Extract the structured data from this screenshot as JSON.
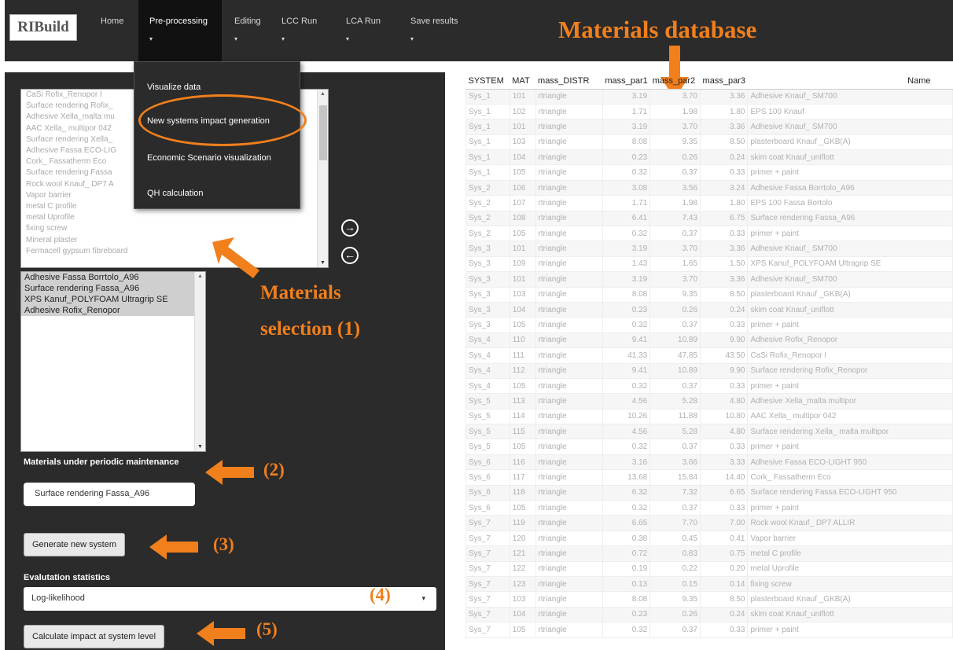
{
  "navbar": {
    "logo": "RIBuild",
    "items": [
      {
        "label": "Home"
      },
      {
        "label": "Pre-processing"
      },
      {
        "label": "Editing"
      },
      {
        "label": "LCC Run"
      },
      {
        "label": "LCA Run"
      },
      {
        "label": "Save results"
      }
    ],
    "caret": "▾"
  },
  "dropdown": {
    "items": [
      {
        "label": "Visualize data"
      },
      {
        "label": "New systems impact generation"
      },
      {
        "label": "Economic Scenario visualization"
      },
      {
        "label": "QH calculation"
      }
    ]
  },
  "materials_list": [
    "CaSi Rofix_Renopor I",
    "Surface rendering Rofix_",
    "Adhesive Xella_malta mu",
    "AAC Xella_ multipor 042",
    "Surface rendering Xella_",
    "Adhesive Fassa ECO-LIG",
    "Cork_ Fassatherm Eco",
    "Surface rendering Fassa",
    "Rock wool Knauf_ DP7 A",
    "Vapor barrier",
    "metal C profile",
    "metal Uprofile",
    "fixing screw",
    "Mineral plaster",
    "Fermacell gypsum fibreboard"
  ],
  "selected_materials": [
    "Adhesive Fassa Borrtolo_A96",
    "Surface rendering Fassa_A96",
    "XPS Kanuf_POLYFOAM Ultragrip SE",
    "Adhesive Rofix_Renopor"
  ],
  "controls": {
    "periodic_label": "Materials under periodic maintenance",
    "periodic_value": "Surface rendering Fassa_A96",
    "generate_button": "Generate new system",
    "eval_label": "Evalutation statistics",
    "eval_value": "Log-likelihood",
    "calc_button": "Calculate impact at system level"
  },
  "annotations": {
    "db_title": "Materials database",
    "selection_line1": "Materials",
    "selection_line2": "selection (1)",
    "n2": "(2)",
    "n3": "(3)",
    "n4": "(4)",
    "n5": "(5)"
  },
  "colors": {
    "accent": "#f07f1c",
    "dark": "#2b2b2b"
  },
  "table": {
    "headers": [
      "SYSTEM",
      "MAT",
      "mass_DISTR",
      "mass_par1",
      "mass_par2",
      "mass_par3",
      "Name"
    ],
    "rows": [
      [
        "Sys_1",
        "101",
        "rtriangle",
        "3.19",
        "3.70",
        "3.36",
        "Adhesive Knauf_ SM700"
      ],
      [
        "Sys_1",
        "102",
        "rtriangle",
        "1.71",
        "1.98",
        "1.80",
        "EPS 100 Knauf"
      ],
      [
        "Sys_1",
        "101",
        "rtriangle",
        "3.19",
        "3.70",
        "3.36",
        "Adhesive Knauf_ SM700"
      ],
      [
        "Sys_1",
        "103",
        "rtriangle",
        "8.08",
        "9.35",
        "8.50",
        "plasterboard Knauf _GKB(A)"
      ],
      [
        "Sys_1",
        "104",
        "rtriangle",
        "0.23",
        "0.26",
        "0.24",
        "skim coat Knauf_uniflott"
      ],
      [
        "Sys_1",
        "105",
        "rtriangle",
        "0.32",
        "0.37",
        "0.33",
        "primer + paint"
      ],
      [
        "Sys_2",
        "106",
        "rtriangle",
        "3.08",
        "3.56",
        "3.24",
        "Adhesive Fassa Borrtolo_A96"
      ],
      [
        "Sys_2",
        "107",
        "rtriangle",
        "1.71",
        "1.98",
        "1.80",
        "EPS 100 Fassa Bortolo"
      ],
      [
        "Sys_2",
        "108",
        "rtriangle",
        "6.41",
        "7.43",
        "6.75",
        "Surface rendering Fassa_A96"
      ],
      [
        "Sys_2",
        "105",
        "rtriangle",
        "0.32",
        "0.37",
        "0.33",
        "primer + paint"
      ],
      [
        "Sys_3",
        "101",
        "rtriangle",
        "3.19",
        "3.70",
        "3.36",
        "Adhesive Knauf_ SM700"
      ],
      [
        "Sys_3",
        "109",
        "rtriangle",
        "1.43",
        "1.65",
        "1.50",
        "XPS Kanuf_POLYFOAM Ultragrip SE"
      ],
      [
        "Sys_3",
        "101",
        "rtriangle",
        "3.19",
        "3.70",
        "3.36",
        "Adhesive Knauf_ SM700"
      ],
      [
        "Sys_3",
        "103",
        "rtriangle",
        "8.08",
        "9.35",
        "8.50",
        "plasterboard Knauf _GKB(A)"
      ],
      [
        "Sys_3",
        "104",
        "rtriangle",
        "0.23",
        "0.26",
        "0.24",
        "skim coat Knauf_uniflott"
      ],
      [
        "Sys_3",
        "105",
        "rtriangle",
        "0.32",
        "0.37",
        "0.33",
        "primer + paint"
      ],
      [
        "Sys_4",
        "110",
        "rtriangle",
        "9.41",
        "10.89",
        "9.90",
        "Adhesive Rofix_Renopor"
      ],
      [
        "Sys_4",
        "111",
        "rtriangle",
        "41.33",
        "47.85",
        "43.50",
        "CaSi Rofix_Renopor I"
      ],
      [
        "Sys_4",
        "112",
        "rtriangle",
        "9.41",
        "10.89",
        "9.90",
        "Surface rendering Rofix_Renopor"
      ],
      [
        "Sys_4",
        "105",
        "rtriangle",
        "0.32",
        "0.37",
        "0.33",
        "primer + paint"
      ],
      [
        "Sys_5",
        "113",
        "rtriangle",
        "4.56",
        "5.28",
        "4.80",
        "Adhesive Xella_malta multipor"
      ],
      [
        "Sys_5",
        "114",
        "rtriangle",
        "10.26",
        "11.88",
        "10.80",
        "AAC Xella_ multipor 042"
      ],
      [
        "Sys_5",
        "115",
        "rtriangle",
        "4.56",
        "5.28",
        "4.80",
        "Surface rendering Xella_ malta multipor"
      ],
      [
        "Sys_5",
        "105",
        "rtriangle",
        "0.32",
        "0.37",
        "0.33",
        "primer + paint"
      ],
      [
        "Sys_6",
        "116",
        "rtriangle",
        "3.16",
        "3.66",
        "3.33",
        "Adhesive Fassa ECO-LIGHT 950"
      ],
      [
        "Sys_6",
        "117",
        "rtriangle",
        "13.68",
        "15.84",
        "14.40",
        "Cork_ Fassatherm Eco"
      ],
      [
        "Sys_6",
        "118",
        "rtriangle",
        "6.32",
        "7.32",
        "6.65",
        "Surface rendering Fassa ECO-LIGHT 950"
      ],
      [
        "Sys_6",
        "105",
        "rtriangle",
        "0.32",
        "0.37",
        "0.33",
        "primer + paint"
      ],
      [
        "Sys_7",
        "119",
        "rtriangle",
        "6.65",
        "7.70",
        "7.00",
        "Rock wool Knauf_ DP7 ALLIR"
      ],
      [
        "Sys_7",
        "120",
        "rtriangle",
        "0.38",
        "0.45",
        "0.41",
        "Vapor barrier"
      ],
      [
        "Sys_7",
        "121",
        "rtriangle",
        "0.72",
        "0.83",
        "0.75",
        "metal C profile"
      ],
      [
        "Sys_7",
        "122",
        "rtriangle",
        "0.19",
        "0.22",
        "0.20",
        "metal Uprofile"
      ],
      [
        "Sys_7",
        "123",
        "rtriangle",
        "0.13",
        "0.15",
        "0.14",
        "fixing screw"
      ],
      [
        "Sys_7",
        "103",
        "rtriangle",
        "8.08",
        "9.35",
        "8.50",
        "plasterboard Knauf _GKB(A)"
      ],
      [
        "Sys_7",
        "104",
        "rtriangle",
        "0.23",
        "0.26",
        "0.24",
        "skim coat Knauf_uniflott"
      ],
      [
        "Sys_7",
        "105",
        "rtriangle",
        "0.32",
        "0.37",
        "0.33",
        "primer + paint"
      ]
    ]
  }
}
